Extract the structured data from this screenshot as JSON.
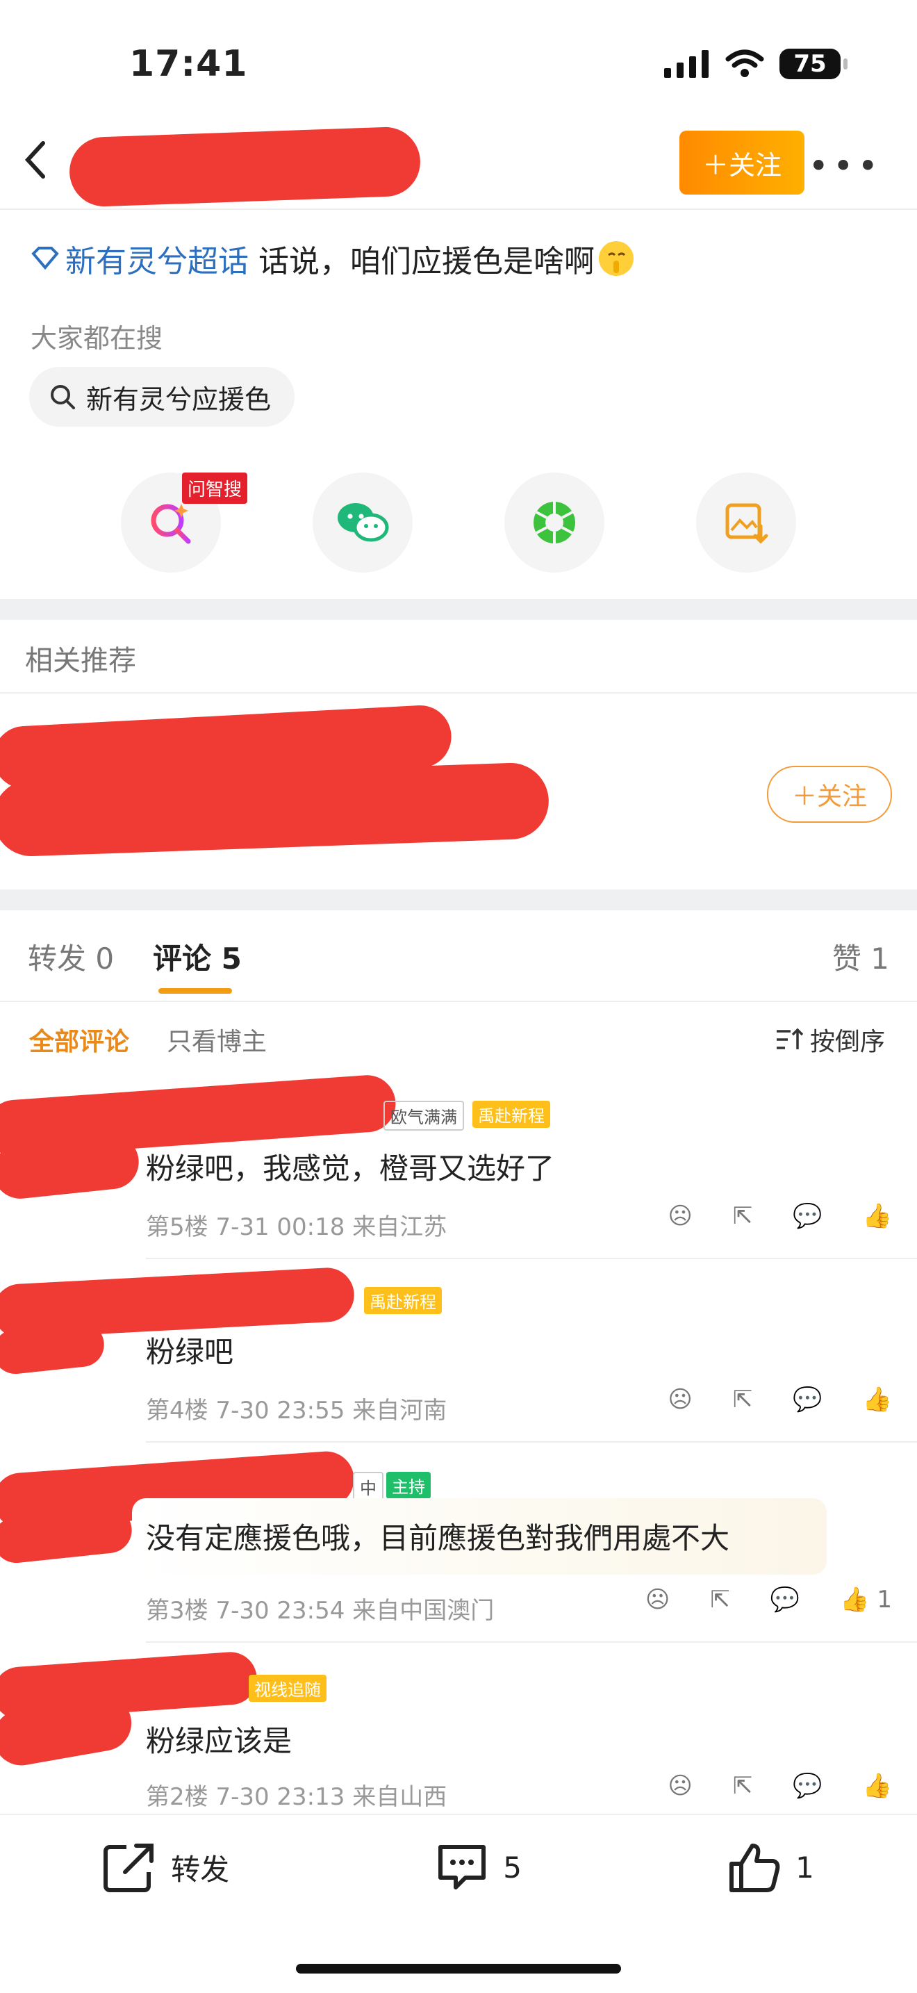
{
  "status": {
    "time": "17:41",
    "battery": "75"
  },
  "header": {
    "follow_label": "＋关注"
  },
  "post": {
    "topic": "新有灵兮超话",
    "text": "话说，咱们应援色是啥啊"
  },
  "hot_search": {
    "label": "大家都在搜",
    "query": "新有灵兮应援色"
  },
  "share": {
    "ai_badge": "问智搜"
  },
  "related": {
    "title": "相关推荐",
    "follow_label": "＋关注"
  },
  "tabs": {
    "repost": "转发",
    "repost_count": "0",
    "comment": "评论",
    "comment_count": "5",
    "like": "赞",
    "like_count": "1"
  },
  "filter": {
    "all": "全部评论",
    "author_only": "只看博主",
    "sort": "按倒序"
  },
  "comments": [
    {
      "tags": [
        "欧气满满",
        "禹赴新程"
      ],
      "text": "粉绿吧，我感觉，橙哥又选好了",
      "meta": "第5楼 7-31 00:18 来自江苏",
      "likes": ""
    },
    {
      "tags": [
        "禹赴新程"
      ],
      "text": "粉绿吧",
      "meta": "第4楼 7-30 23:55 来自河南",
      "likes": ""
    },
    {
      "tags": [
        "中",
        "主持"
      ],
      "text": "没有定應援色哦，目前應援色對我們用處不大",
      "meta": "第3楼 7-30 23:54 来自中国澳门",
      "likes": "1"
    },
    {
      "tags": [
        "视线追随"
      ],
      "text": "粉绿应该是",
      "meta": "第2楼 7-30 23:13 来自山西",
      "likes": ""
    }
  ],
  "bottom": {
    "repost": "转发",
    "comments": "5",
    "likes": "1"
  },
  "colors": {
    "accent": "#ff9500",
    "link": "#2c6fbf",
    "redaction": "#ef3b33"
  }
}
